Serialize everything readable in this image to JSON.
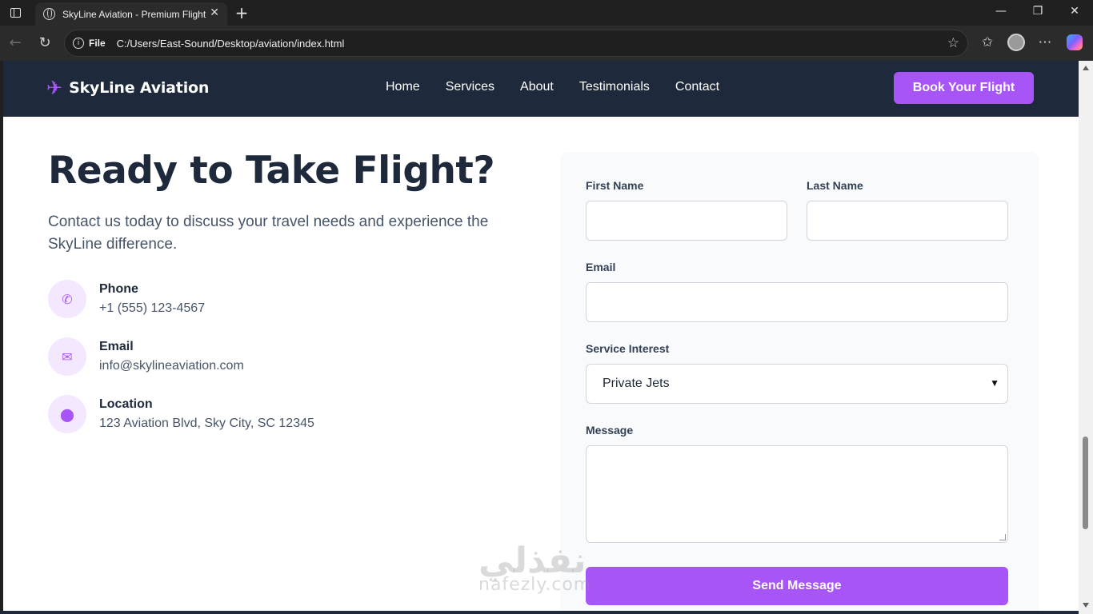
{
  "browser": {
    "tab_title": "SkyLine Aviation - Premium Flight",
    "address_scheme": "File",
    "address_path": "C:/Users/East-Sound/Desktop/aviation/index.html"
  },
  "nav": {
    "brand": "SkyLine Aviation",
    "links": [
      "Home",
      "Services",
      "About",
      "Testimonials",
      "Contact"
    ],
    "cta": "Book Your Flight"
  },
  "contact": {
    "heading": "Ready to Take Flight?",
    "lead": "Contact us today to discuss your travel needs and experience the SkyLine difference.",
    "items": [
      {
        "label": "Phone",
        "value": "+1 (555) 123-4567",
        "icon": "phone-icon"
      },
      {
        "label": "Email",
        "value": "info@skylineaviation.com",
        "icon": "envelope-icon"
      },
      {
        "label": "Location",
        "value": "123 Aviation Blvd, Sky City, SC 12345",
        "icon": "map-pin-icon"
      }
    ]
  },
  "form": {
    "first_name_label": "First Name",
    "last_name_label": "Last Name",
    "email_label": "Email",
    "service_label": "Service Interest",
    "service_selected": "Private Jets",
    "message_label": "Message",
    "submit_label": "Send Message"
  },
  "watermark": {
    "arabic": "نفذلي",
    "latin": "nafezly.com"
  },
  "colors": {
    "nav_bg": "#1e293b",
    "accent": "#a855f7",
    "icon_bg": "#f3e8ff",
    "heading": "#1e293b"
  }
}
